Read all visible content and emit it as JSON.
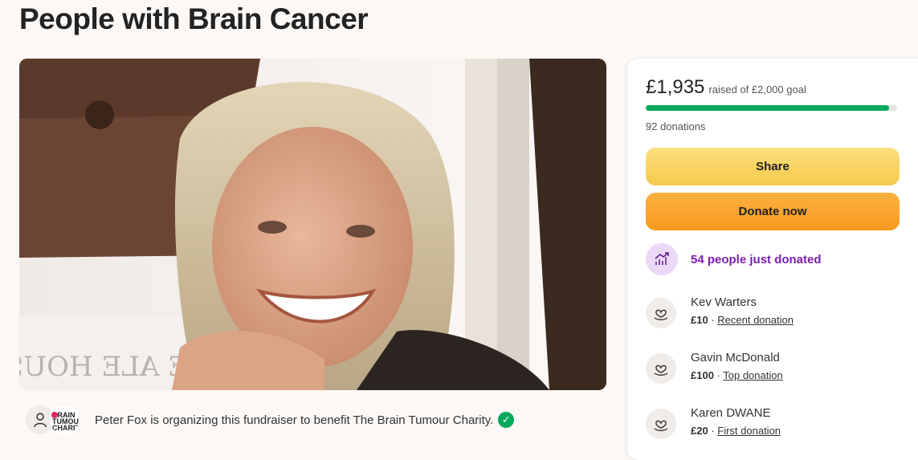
{
  "page_title": "People with Brain Cancer",
  "organizer": {
    "text": "Peter Fox is organizing this fundraiser to benefit The Brain Tumour Charity.",
    "charity_logo_text": "BRAIN TUMOUR CHARITY"
  },
  "photo_signage": "E ALE HOUS",
  "summary": {
    "raised": "£1,935",
    "goal_text": "raised of £2,000 goal",
    "progress_fraction": 0.9675,
    "donations": "92 donations"
  },
  "buttons": {
    "share": "Share",
    "donate": "Donate now"
  },
  "trend": {
    "text": "54 people just donated"
  },
  "donors": [
    {
      "name": "Kev Warters",
      "amount": "£10",
      "tag": "Recent donation"
    },
    {
      "name": "Gavin McDonald",
      "amount": "£100",
      "tag": "Top donation"
    },
    {
      "name": "Karen DWANE",
      "amount": "£20",
      "tag": "First donation"
    }
  ],
  "colors": {
    "progress": "#02a95c",
    "share_button": "#f6c94c",
    "donate_button": "#f79a1e",
    "trend_text": "#7a1fb0"
  }
}
